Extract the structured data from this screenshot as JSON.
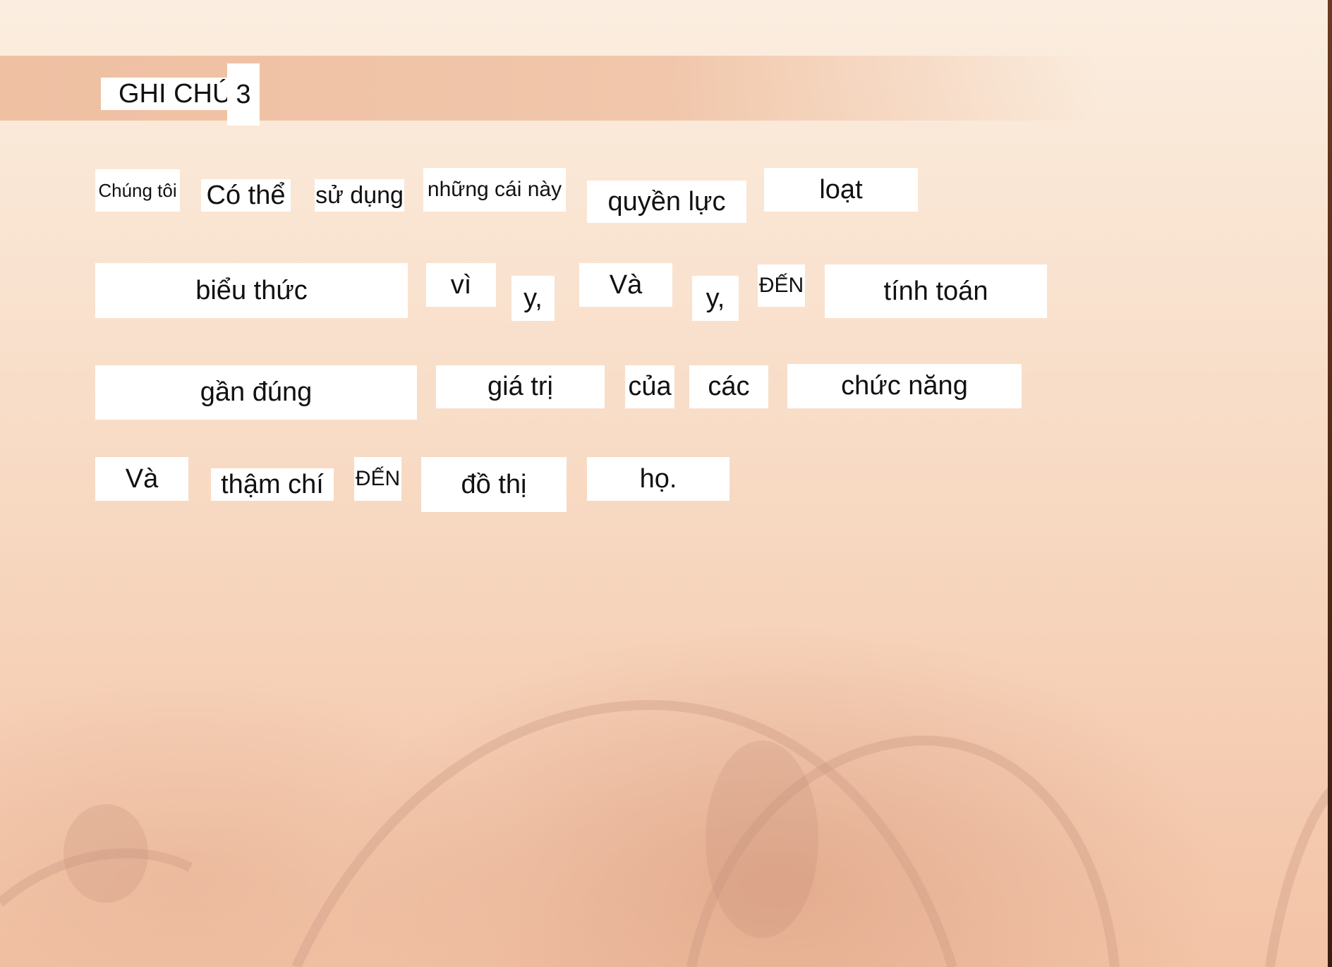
{
  "slide": {
    "title_part1": "GHI CHÚ",
    "title_part2": "3",
    "lines": [
      [
        "Chúng tôi",
        "Có thể",
        "sử dụng",
        "những cái này",
        "quyền lực",
        "loạt"
      ],
      [
        "biểu thức",
        "vì",
        "y,",
        "Và",
        "y,",
        "ĐẾN",
        "tính toán"
      ],
      [
        "gần đúng",
        "giá trị",
        "của",
        "các",
        "chức năng"
      ],
      [
        "Và",
        "thậm chí",
        "ĐẾN",
        "đồ thị",
        "họ."
      ]
    ]
  }
}
